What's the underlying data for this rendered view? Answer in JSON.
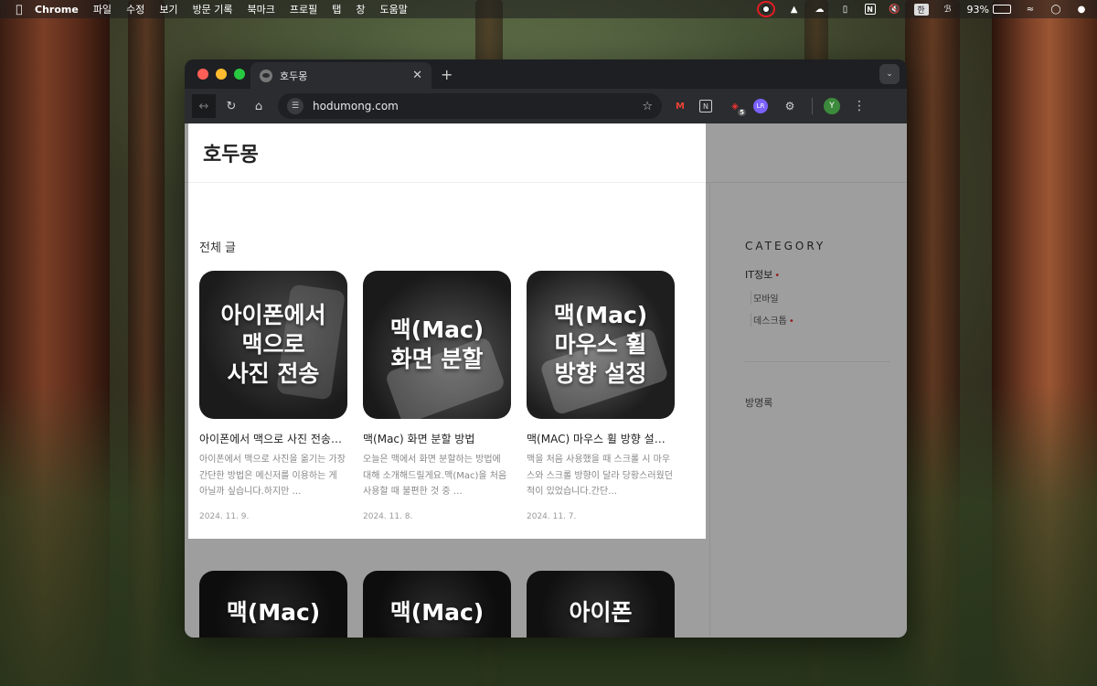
{
  "menubar": {
    "app_name": "Chrome",
    "items": [
      "파일",
      "수정",
      "보기",
      "방문 기록",
      "북마크",
      "프로필",
      "탭",
      "창",
      "도움말"
    ],
    "input_source": "한",
    "battery_percent": "93%",
    "battery_level": 0.93
  },
  "browser": {
    "tab_title": "호두몽",
    "url": "hodumong.com",
    "ublock_badge": "5",
    "profile_initial": "Y",
    "ext_lr": "LR"
  },
  "site": {
    "title": "호두몽",
    "section_title": "전체 글",
    "posts": [
      {
        "thumb_text": "아이폰에서\n맥으로\n사진 전송",
        "title": "아이폰에서 맥으로 사진 전송하는 방법",
        "excerpt": "아이폰에서 맥으로 사진을 옮기는 가장 간단한 방법은 메신저를 이용하는 게 아닐까 싶습니다.하지만 …",
        "date": "2024. 11. 9."
      },
      {
        "thumb_text": "맥(Mac)\n화면 분할",
        "title": "맥(Mac) 화면 분할 방법",
        "excerpt": "오늘은 맥에서  화면 분할하는 방법에 대해 소개해드릴게요.맥(Mac)을 처음 사용할 때 불편한 것 중 …",
        "date": "2024. 11. 8."
      },
      {
        "thumb_text": "맥(Mac)\n마우스 휠\n방향 설정",
        "title": "맥(MAC) 마우스 휠 방향 설정 방법",
        "excerpt": "맥을 처음 사용했을 때 스크롤 시 마우스와 스크롤 방향이 달라 당황스러웠던 적이 있었습니다.간단…",
        "date": "2024. 11. 7."
      }
    ],
    "more_thumbs": [
      "맥(Mac)",
      "맥(Mac)",
      "아이폰"
    ],
    "sidebar": {
      "category_heading": "CATEGORY",
      "main_category": "IT정보",
      "sub_categories": [
        "모바일",
        "데스크톱"
      ],
      "guestbook": "방명록"
    }
  },
  "colors": {
    "accent_red": "#e33333",
    "traffic_red": "#ff5f57",
    "traffic_yellow": "#febc2e",
    "traffic_green": "#28c840"
  },
  "icons": {
    "apple": "apple-logo-icon",
    "record": "screen-record-icon",
    "wifi": "wifi-icon",
    "bluetooth": "bluetooth-icon",
    "star": "bookmark-star-icon"
  }
}
